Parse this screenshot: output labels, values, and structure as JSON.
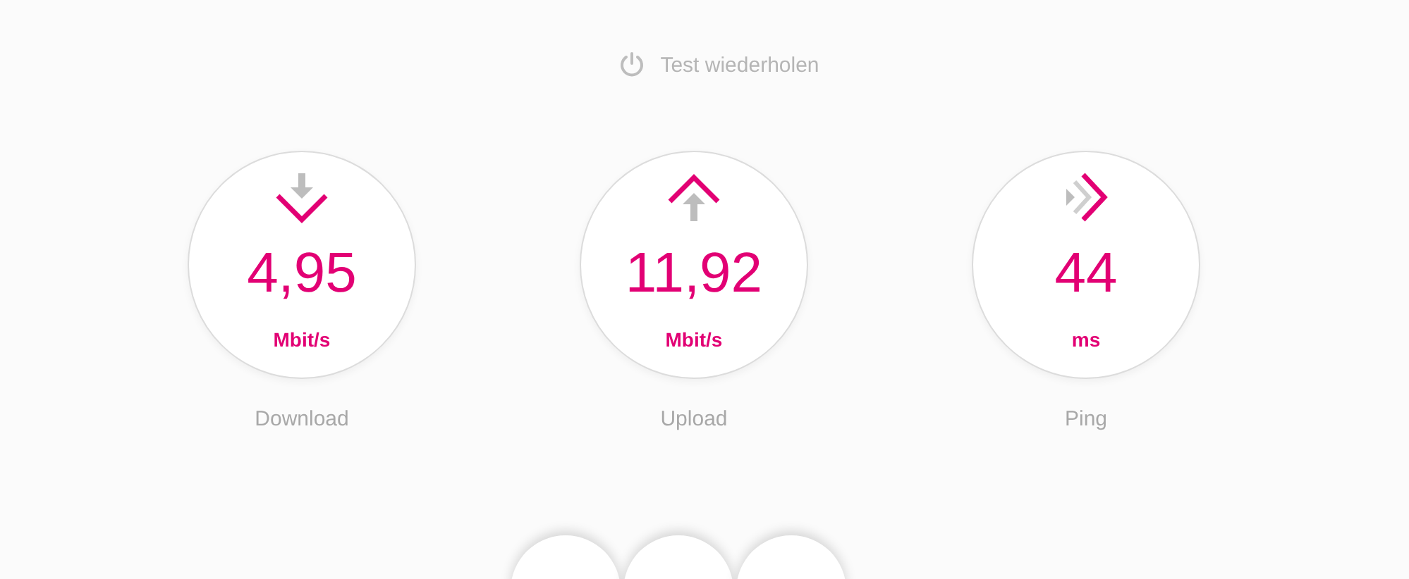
{
  "repeat_button": {
    "label": "Test wiederholen"
  },
  "metrics": [
    {
      "kind": "download",
      "value": "4,95",
      "unit": "Mbit/s",
      "label": "Download"
    },
    {
      "kind": "upload",
      "value": "11,92",
      "unit": "Mbit/s",
      "label": "Upload"
    },
    {
      "kind": "ping",
      "value": "44",
      "unit": "ms",
      "label": "Ping"
    }
  ]
}
